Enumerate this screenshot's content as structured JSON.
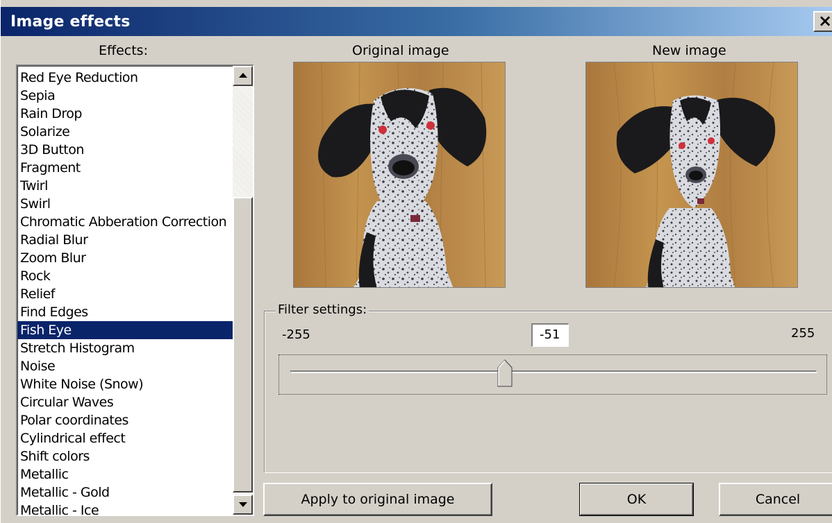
{
  "window": {
    "title": "Image effects",
    "close_glyph": "×"
  },
  "effects": {
    "label": "Effects:",
    "items": [
      "Red Eye Reduction",
      "Sepia",
      "Rain Drop",
      "Solarize",
      "3D Button",
      "Fragment",
      "Twirl",
      "Swirl",
      "Chromatic Abberation Correction",
      "Radial Blur",
      "Zoom Blur",
      "Rock",
      "Relief",
      "Find Edges",
      "Fish Eye",
      "Stretch Histogram",
      "Noise",
      "White Noise (Snow)",
      "Circular Waves",
      "Polar coordinates",
      "Cylindrical effect",
      "Shift colors",
      "Metallic",
      "Metallic - Gold",
      "Metallic - Ice"
    ],
    "selected_index": 14
  },
  "preview": {
    "original_label": "Original image",
    "new_label": "New image"
  },
  "filter": {
    "label": "Filter settings:",
    "min_label": "-255",
    "max_label": "255",
    "value": "-51",
    "min": -255,
    "max": 255,
    "slider_value": -51
  },
  "buttons": {
    "apply": "Apply to original image",
    "ok": "OK",
    "cancel": "Cancel"
  },
  "colors": {
    "title_gradient_start": "#0a246a",
    "title_gradient_end": "#a6caf0",
    "face": "#d4d0c8",
    "selection": "#0a246a",
    "wood": "#b8864a",
    "dog_dark": "#1a1a1c"
  }
}
